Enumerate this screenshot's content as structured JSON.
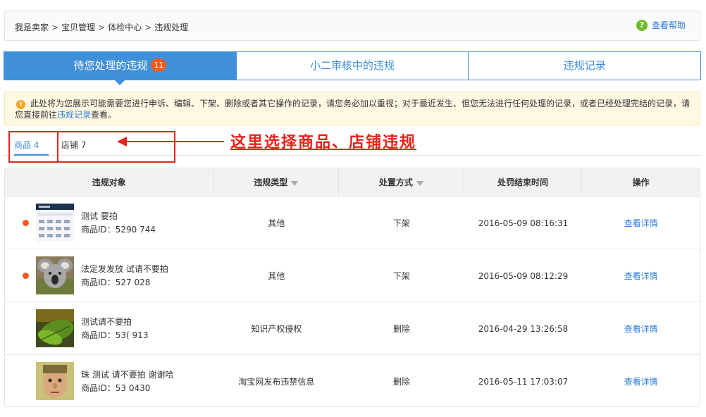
{
  "breadcrumb": {
    "items": [
      "我是卖家",
      "宝贝管理",
      "体检中心",
      "违规处理"
    ],
    "separator": ">"
  },
  "help": {
    "label": "查看帮助",
    "icon": "question-icon"
  },
  "tabs": [
    {
      "label": "待您处理的违规",
      "badge": "11",
      "active": true
    },
    {
      "label": "小二审核中的违规",
      "active": false
    },
    {
      "label": "违规记录",
      "active": false
    }
  ],
  "notice": {
    "text_before": "此处将为您展示可能需要您进行申诉、编辑、下架、删除或者其它操作的记录，请您务必加以重视；对于最近发生、但您无法进行任何处理的记录，或者已经处理完结的记录，请您直接前往",
    "link": "违规记录",
    "text_after": "查看。"
  },
  "subtabs": [
    {
      "label": "商品 4",
      "active": true
    },
    {
      "label": "店铺 7",
      "active": false
    }
  ],
  "annotation": "这里选择商品、店铺违规",
  "table": {
    "headers": [
      "违规对象",
      "违规类型",
      "处置方式",
      "处罚结束时间",
      "操作"
    ],
    "rows": [
      {
        "unread": true,
        "title": "测试   要拍",
        "id": "商品ID：5290        744",
        "type": "其他",
        "action": "下架",
        "end_time": "2016-05-09 08:16:31",
        "op": "查看详情"
      },
      {
        "unread": true,
        "title": "法定发发放        试请不要拍",
        "id": "商品ID：527         028",
        "type": "其他",
        "action": "下架",
        "end_time": "2016-05-09 08:12:29",
        "op": "查看详情"
      },
      {
        "unread": false,
        "title": "测试请不要拍",
        "id": "商品ID：53(        913",
        "type": "知识产权侵权",
        "action": "删除",
        "end_time": "2016-04-29 13:26:58",
        "op": "查看详情"
      },
      {
        "unread": false,
        "title": "珠 测试 请不要拍 谢谢哈",
        "id": "商品ID：53            0430",
        "type": "淘宝网发布违禁信息",
        "action": "删除",
        "end_time": "2016-05-11 17:03:07",
        "op": "查看详情"
      }
    ]
  },
  "colors": {
    "accent": "#3f8fd9",
    "badge": "#f05a1f",
    "annotation": "#e8231c",
    "link": "#2b7bd6"
  }
}
